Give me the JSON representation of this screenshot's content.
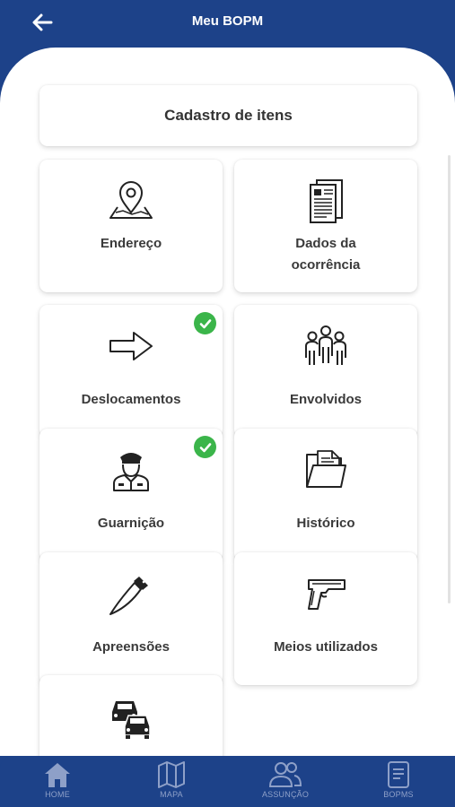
{
  "header": {
    "title": "Meu BOPM",
    "back_icon": "arrow-left-icon"
  },
  "section": {
    "title": "Cadastro de itens"
  },
  "tiles": [
    {
      "label": "Endereço",
      "icon": "map-pin-icon",
      "checked": false
    },
    {
      "label": "Dados da ocorrência",
      "icon": "document-icon",
      "checked": false
    },
    {
      "label": "Deslocamentos",
      "icon": "arrow-right-icon",
      "checked": true
    },
    {
      "label": "Envolvidos",
      "icon": "people-group-icon",
      "checked": false
    },
    {
      "label": "Guarnição",
      "icon": "police-officer-icon",
      "checked": true
    },
    {
      "label": "Histórico",
      "icon": "folder-icon",
      "checked": false
    },
    {
      "label": "Apreensões",
      "icon": "knife-icon",
      "checked": false
    },
    {
      "label": "Meios utilizados",
      "icon": "pistol-icon",
      "checked": false
    },
    {
      "label": "",
      "icon": "cars-icon",
      "checked": false
    }
  ],
  "bottom_nav": [
    {
      "label": "HOME",
      "icon": "home-icon"
    },
    {
      "label": "MAPA",
      "icon": "map-icon"
    },
    {
      "label": "ASSUNÇÃO",
      "icon": "users-icon"
    },
    {
      "label": "BOPMS",
      "icon": "file-icon"
    }
  ],
  "colors": {
    "primary": "#1d4289",
    "check": "#3bb54a",
    "nav_inactive": "#8ea0c8"
  }
}
